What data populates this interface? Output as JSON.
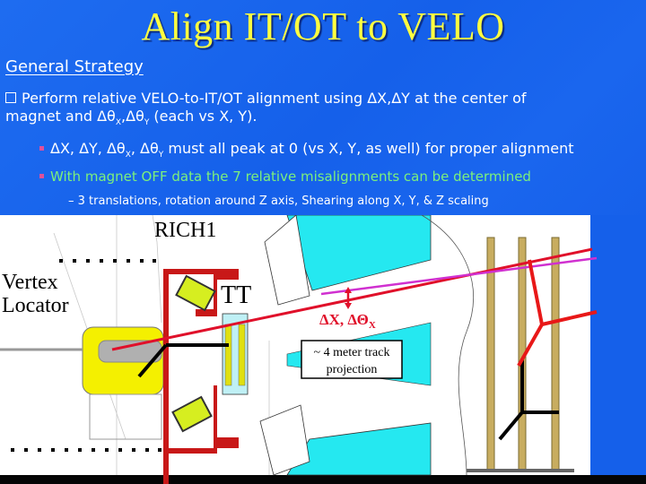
{
  "slide": {
    "title": "Align IT/OT to VELO",
    "subheading": "General Strategy",
    "main_point_line1": "Perform relative VELO-to-IT/OT alignment using ΔX,ΔY at the center of",
    "main_point_line2_a": "magnet and Δθ",
    "main_point_line2_sub1": "X",
    "main_point_line2_b": ",Δθ",
    "main_point_line2_sub2": "Y",
    "main_point_line2_c": " (each vs X, Y).",
    "bullet1_a": "ΔX, ΔY, Δθ",
    "bullet1_sub1": "X",
    "bullet1_b": ", Δθ",
    "bullet1_sub2": "Y",
    "bullet1_c": " must all peak at 0 (vs X, Y, as well) for proper alignment",
    "bullet2": "With magnet OFF data the 7 relative misalignments can be determined",
    "sub_bullet": "– 3 translations, rotation around Z axis, Shearing along X, Y, & Z scaling"
  },
  "diagram": {
    "label_rich": "RICH1",
    "label_vertex1": "Vertex",
    "label_vertex2": "Locator",
    "label_tt": "TT",
    "label_delta": "ΔX, ΔΘ",
    "label_delta_sub": "X",
    "callout_line1": "~ 4 meter track",
    "callout_line2": "projection"
  },
  "colors": {
    "title": "#ffff40",
    "green_text": "#7cf07c",
    "bullet": "#e0509a",
    "track_red": "#e0102a",
    "track_magenta": "#d030d0",
    "cyan": "#20e8f0"
  }
}
